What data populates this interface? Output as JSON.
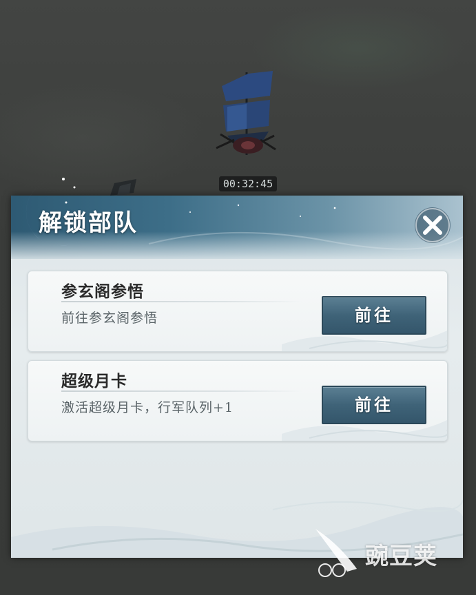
{
  "game": {
    "timer": "00:32:45"
  },
  "dialog": {
    "title": "解锁部队",
    "close_icon": "close-icon",
    "options": [
      {
        "title": "参玄阁参悟",
        "description": "前往参玄阁参悟",
        "button_label": "前往"
      },
      {
        "title": "超级月卡",
        "description": "激活超级月卡，行军队列+1",
        "button_label": "前往"
      }
    ]
  },
  "watermark": {
    "text": "豌豆荚"
  },
  "colors": {
    "header": "#3d6e88",
    "button": "#3f6378",
    "panel": "#e6ecee"
  }
}
